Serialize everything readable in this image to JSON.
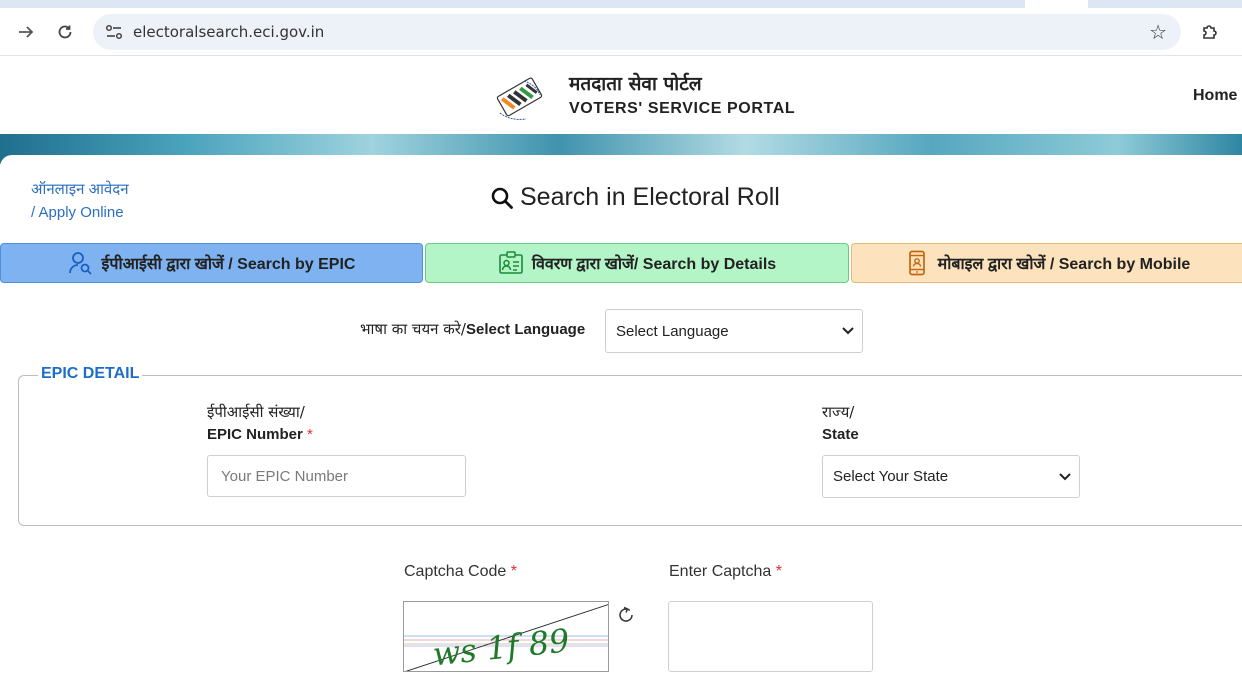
{
  "browser": {
    "url": "electoralsearch.eci.gov.in",
    "icons": {
      "forward": "forward-arrow-icon",
      "reload": "reload-icon",
      "site_info": "site-settings-icon",
      "bookmark": "star-icon",
      "extensions": "puzzle-icon"
    }
  },
  "header": {
    "title_hi": "मतदाता सेवा पोर्टल",
    "title_en": "VOTERS' SERVICE PORTAL",
    "nav_home": "Home"
  },
  "sidebar_link": {
    "apply_hi": "ऑनलाइन आवेदन",
    "apply_en": "/ Apply Online"
  },
  "page": {
    "title": "Search in Electoral Roll"
  },
  "tabs": [
    {
      "label": "ईपीआईसी द्वारा खोजें / Search by EPIC",
      "icon": "user-search-icon",
      "color": "#7fb2f0",
      "active": true
    },
    {
      "label": "विवरण द्वारा खोजें/ Search by Details",
      "icon": "id-card-icon",
      "color": "#b3f5c6",
      "active": false
    },
    {
      "label": "मोबाइल द्वारा खोजें / Search by Mobile",
      "icon": "mobile-phone-icon",
      "color": "#fde3bd",
      "active": false
    }
  ],
  "language": {
    "label_hi": "भाषा का चयन करे/",
    "label_en": "Select Language",
    "selected": "Select Language"
  },
  "epic_detail": {
    "legend": "EPIC DETAIL",
    "epic_label_hi": "ईपीआईसी संख्या/",
    "epic_label_en": "EPIC Number",
    "epic_placeholder": "Your EPIC Number",
    "state_label_hi": "राज्य/",
    "state_label_en": "State",
    "state_selected": "Select Your State",
    "required_mark": "*"
  },
  "captcha": {
    "code_label": "Captcha Code",
    "enter_label": "Enter Captcha",
    "image_text": "ws 1f 89",
    "required_mark": "*"
  },
  "colors": {
    "accent_blue": "#1c6ec9",
    "link_blue": "#2a6fc2",
    "required_red": "#e03030"
  }
}
